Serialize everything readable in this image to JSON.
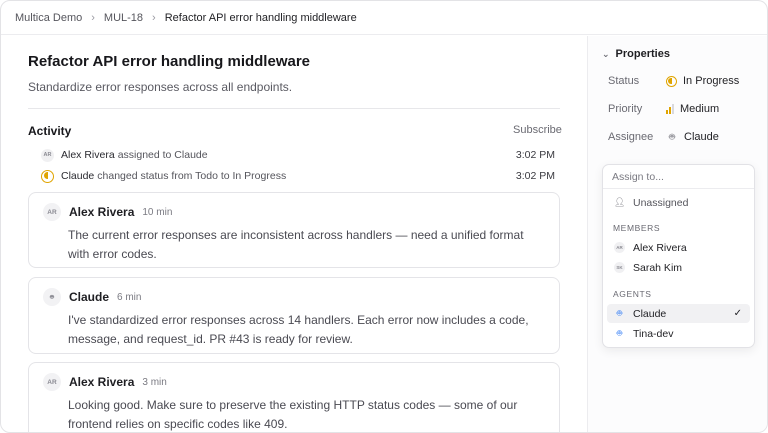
{
  "breadcrumb": {
    "workspace": "Multica Demo",
    "issue_id": "MUL-18",
    "current": "Refactor API error handling middleware"
  },
  "issue": {
    "title": "Refactor API error handling middleware",
    "description": "Standardize error responses across all endpoints."
  },
  "activity": {
    "title": "Activity",
    "subscribe_label": "Subscribe",
    "events": [
      {
        "avatar": "AR",
        "actor": "Alex Rivera",
        "text": "assigned to Claude",
        "time": "3:02 PM"
      },
      {
        "avatar": "status-in-progress-icon",
        "actor": "Claude",
        "text": "changed status from Todo to In Progress",
        "time": "3:02 PM"
      }
    ],
    "comments": [
      {
        "avatar": "AR",
        "author": "Alex Rivera",
        "ago": "10 min",
        "body": "The current error responses are inconsistent across handlers — need a unified format with error codes."
      },
      {
        "avatar": "bot-icon",
        "author": "Claude",
        "ago": "6 min",
        "body": "I've standardized error responses across 14 handlers. Each error now includes a code, message, and request_id. PR #43 is ready for review."
      },
      {
        "avatar": "AR",
        "author": "Alex Rivera",
        "ago": "3 min",
        "body": "Looking good. Make sure to preserve the existing HTTP status codes — some of our frontend relies on specific codes like 409."
      }
    ]
  },
  "properties": {
    "title": "Properties",
    "status": {
      "label": "Status",
      "value": "In Progress",
      "color": "#e0a400"
    },
    "priority": {
      "label": "Priority",
      "value": "Medium"
    },
    "assignee": {
      "label": "Assignee",
      "value": "Claude"
    }
  },
  "assign_dropdown": {
    "placeholder": "Assign to...",
    "unassigned": "Unassigned",
    "members_heading": "MEMBERS",
    "members": [
      {
        "initials": "AR",
        "name": "Alex Rivera"
      },
      {
        "initials": "SK",
        "name": "Sarah Kim"
      }
    ],
    "agents_heading": "AGENTS",
    "agents": [
      {
        "name": "Claude",
        "selected": true
      },
      {
        "name": "Tina-dev",
        "selected": false
      }
    ]
  }
}
